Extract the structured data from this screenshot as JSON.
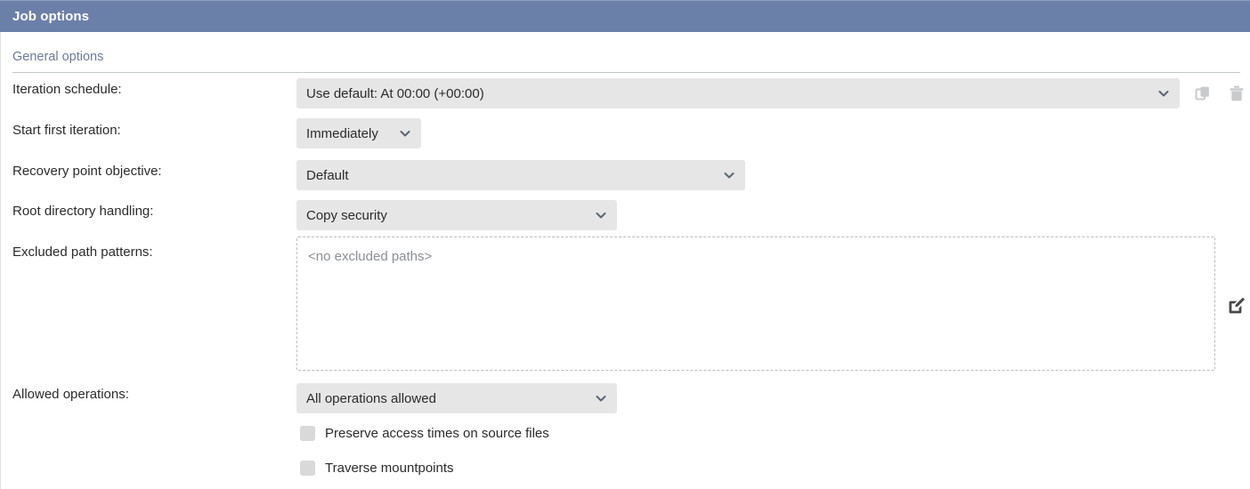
{
  "window": {
    "title": "Job options"
  },
  "section": {
    "title": "General options"
  },
  "fields": {
    "iteration_schedule": {
      "label": "Iteration schedule:",
      "value": "Use default: At 00:00 (+00:00)"
    },
    "start_first_iteration": {
      "label": "Start first iteration:",
      "value": "Immediately"
    },
    "recovery_point_objective": {
      "label": "Recovery point objective:",
      "value": "Default"
    },
    "root_directory_handling": {
      "label": "Root directory handling:",
      "value": "Copy security"
    },
    "excluded_path_patterns": {
      "label": "Excluded path patterns:",
      "placeholder": "<no excluded paths>",
      "value": ""
    },
    "allowed_operations": {
      "label": "Allowed operations:",
      "value": "All operations allowed"
    }
  },
  "checkboxes": [
    {
      "label": "Preserve access times on source files",
      "checked": false
    },
    {
      "label": "Traverse mountpoints",
      "checked": false
    }
  ],
  "icons": {
    "copy": "copy-icon",
    "delete": "trash-icon",
    "edit": "edit-pencil-icon",
    "dropdown": "chevron-down-icon"
  },
  "colors": {
    "titlebar": "#6b80a8",
    "field_background": "#e6e6e6",
    "section_title": "#6b7b96",
    "placeholder": "#8a8f96",
    "checkbox": "#d9d9d9",
    "icon_gray": "#c9cacb",
    "icon_dark": "#4a4a4a"
  }
}
